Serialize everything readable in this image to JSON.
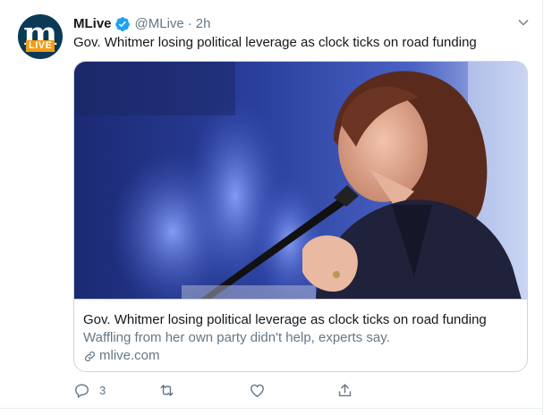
{
  "tweet": {
    "author": {
      "name": "MLive",
      "handle": "@MLive",
      "separator": "·",
      "time": "2h",
      "verified": true,
      "avatar": {
        "letter": "m",
        "tag": "LIVE",
        "bg_color": "#0b3a57",
        "tag_color": "#f39c12"
      }
    },
    "text": "Gov. Whitmer losing political leverage as clock ticks on road funding",
    "card": {
      "image_icon": "photo-of-speaker-at-microphone",
      "title": "Gov. Whitmer losing political leverage as clock ticks on road funding",
      "description": "Waffling from her own party didn't help, experts say.",
      "domain": "mlive.com"
    },
    "actions": {
      "reply_count": "3",
      "retweet_count": "",
      "like_count": ""
    }
  },
  "colors": {
    "accent": "#1da1f2",
    "muted": "#657786",
    "text": "#14171a",
    "border": "#ccd6dd"
  }
}
